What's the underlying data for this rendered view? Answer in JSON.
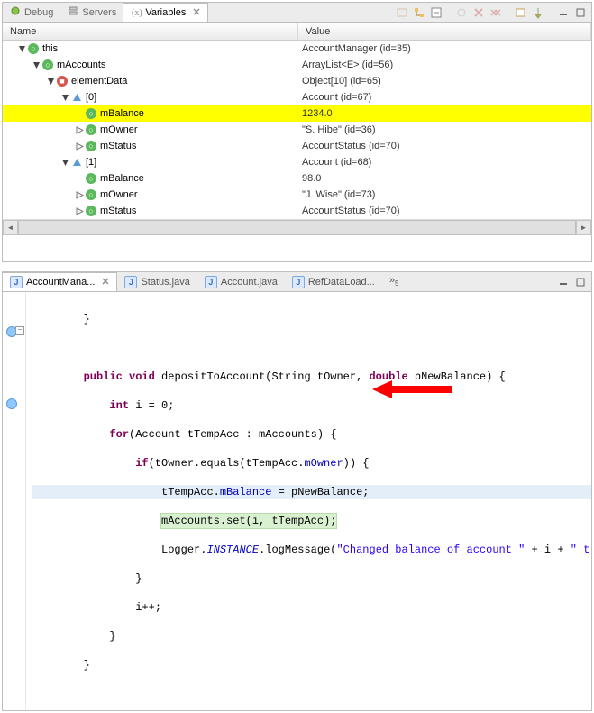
{
  "top_tabs": {
    "debug": "Debug",
    "servers": "Servers",
    "variables": "Variables"
  },
  "columns": {
    "name": "Name",
    "value": "Value"
  },
  "tree": [
    {
      "depth": 1,
      "expand": "open",
      "icon": "green",
      "label": "this",
      "value": "AccountManager  (id=35)",
      "sel": false
    },
    {
      "depth": 2,
      "expand": "open",
      "icon": "green",
      "label": "mAccounts",
      "value": "ArrayList<E>  (id=56)",
      "sel": false
    },
    {
      "depth": 3,
      "expand": "open",
      "icon": "red",
      "label": "elementData",
      "value": "Object[10]  (id=65)",
      "sel": false
    },
    {
      "depth": 4,
      "expand": "open",
      "icon": "blue",
      "label": "[0]",
      "value": "Account  (id=67)",
      "sel": false
    },
    {
      "depth": 5,
      "expand": "none",
      "icon": "green",
      "label": "mBalance",
      "value": "1234.0",
      "sel": true
    },
    {
      "depth": 5,
      "expand": "closed",
      "icon": "green",
      "label": "mOwner",
      "value": "\"S. Hibe\"  (id=36)",
      "sel": false
    },
    {
      "depth": 5,
      "expand": "closed",
      "icon": "green",
      "label": "mStatus",
      "value": "AccountStatus  (id=70)",
      "sel": false
    },
    {
      "depth": 4,
      "expand": "open",
      "icon": "blue",
      "label": "[1]",
      "value": "Account  (id=68)",
      "sel": false
    },
    {
      "depth": 5,
      "expand": "none",
      "icon": "green",
      "label": "mBalance",
      "value": "98.0",
      "sel": false
    },
    {
      "depth": 5,
      "expand": "closed",
      "icon": "green",
      "label": "mOwner",
      "value": "\"J. Wise\"  (id=73)",
      "sel": false
    },
    {
      "depth": 5,
      "expand": "closed",
      "icon": "green",
      "label": "mStatus",
      "value": "AccountStatus  (id=70)",
      "sel": false
    }
  ],
  "editor_tabs": {
    "acct_mgr": "AccountMana...",
    "status": "Status.java",
    "account": "Account.java",
    "refdata": "RefDataLoad..."
  },
  "code": {
    "l0": "        }",
    "l1": "",
    "l2_pre": "        ",
    "l2_kw1": "public",
    "l2_kw2": "void",
    "l2_mid": " depositToAccount(String tOwner, ",
    "l2_kw3": "double",
    "l2_end": " pNewBalance) {",
    "l3_pre": "            ",
    "l3_kw": "int",
    "l3_end": " i = 0;",
    "l4_pre": "            ",
    "l4_kw": "for",
    "l4_end": "(Account tTempAcc : mAccounts) {",
    "l5_pre": "                ",
    "l5_kw": "if",
    "l5_mid": "(tOwner.equals(tTempAcc.",
    "l5_fld": "mOwner",
    "l5_end": ")) {",
    "l6_pre": "                    ",
    "l6_txt": "tTempAcc.",
    "l6_fld": "mBalance",
    "l6_end": " = pNewBalance;",
    "l7_pre": "                    ",
    "l7_txt": "mAccounts.set(i, tTempAcc);",
    "l8_pre": "                    ",
    "l8_a": "Logger.",
    "l8_s": "INSTANCE",
    "l8_b": ".logMessage(",
    "l8_str": "\"Changed balance of account \"",
    "l8_c": " + i + ",
    "l8_str2": "\" t",
    "l9": "                }",
    "l10": "                i++;",
    "l11": "            }",
    "l12": "        }"
  }
}
